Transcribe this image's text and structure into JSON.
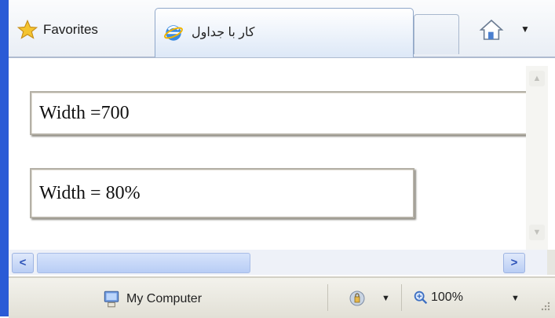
{
  "tabbar": {
    "favorites_label": "Favorites",
    "active_tab_title": "کار با جداول",
    "icons": [
      "favorites-star-icon",
      "ie-icon",
      "home-icon",
      "chevron-down-icon"
    ]
  },
  "content": {
    "box1_text": "Width =700",
    "box2_text": "Width = 80%"
  },
  "scrollbar": {
    "left_arrow": "<",
    "right_arrow": ">",
    "up_arrow": "▲",
    "down_arrow": "▼"
  },
  "statusbar": {
    "zone_label": "My Computer",
    "zoom_label": "100%",
    "dropdown_arrow": "▼"
  },
  "colors": {
    "accent": "#2a5bd6",
    "tab_border": "#8fa7c9",
    "box_border": "#b4b0a6"
  }
}
